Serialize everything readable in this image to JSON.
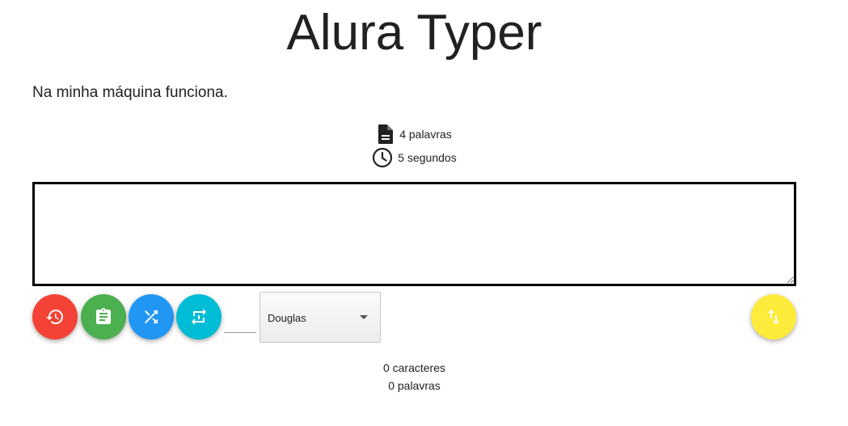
{
  "header": {
    "title": "Alura Typer"
  },
  "phrase": {
    "text": "Na minha máquina funciona."
  },
  "info": {
    "word_count": "4 palavras",
    "time": "5 segundos"
  },
  "typing_area": {
    "value": "",
    "placeholder": ""
  },
  "controls": {
    "restart": {
      "icon": "restore-icon",
      "color": "#f44336"
    },
    "scoreboard": {
      "icon": "assignment-icon",
      "color": "#4caf50"
    },
    "shuffle": {
      "icon": "shuffle-icon",
      "color": "#2196f3"
    },
    "sync": {
      "icon": "swap-icon",
      "color": "#00bcd4"
    },
    "sort": {
      "icon": "swap-vert-icon",
      "color": "#ffeb3b"
    },
    "time_input_value": "",
    "user_select_value": "Douglas"
  },
  "counters": {
    "characters": "0 caracteres",
    "words": "0 palavras"
  }
}
